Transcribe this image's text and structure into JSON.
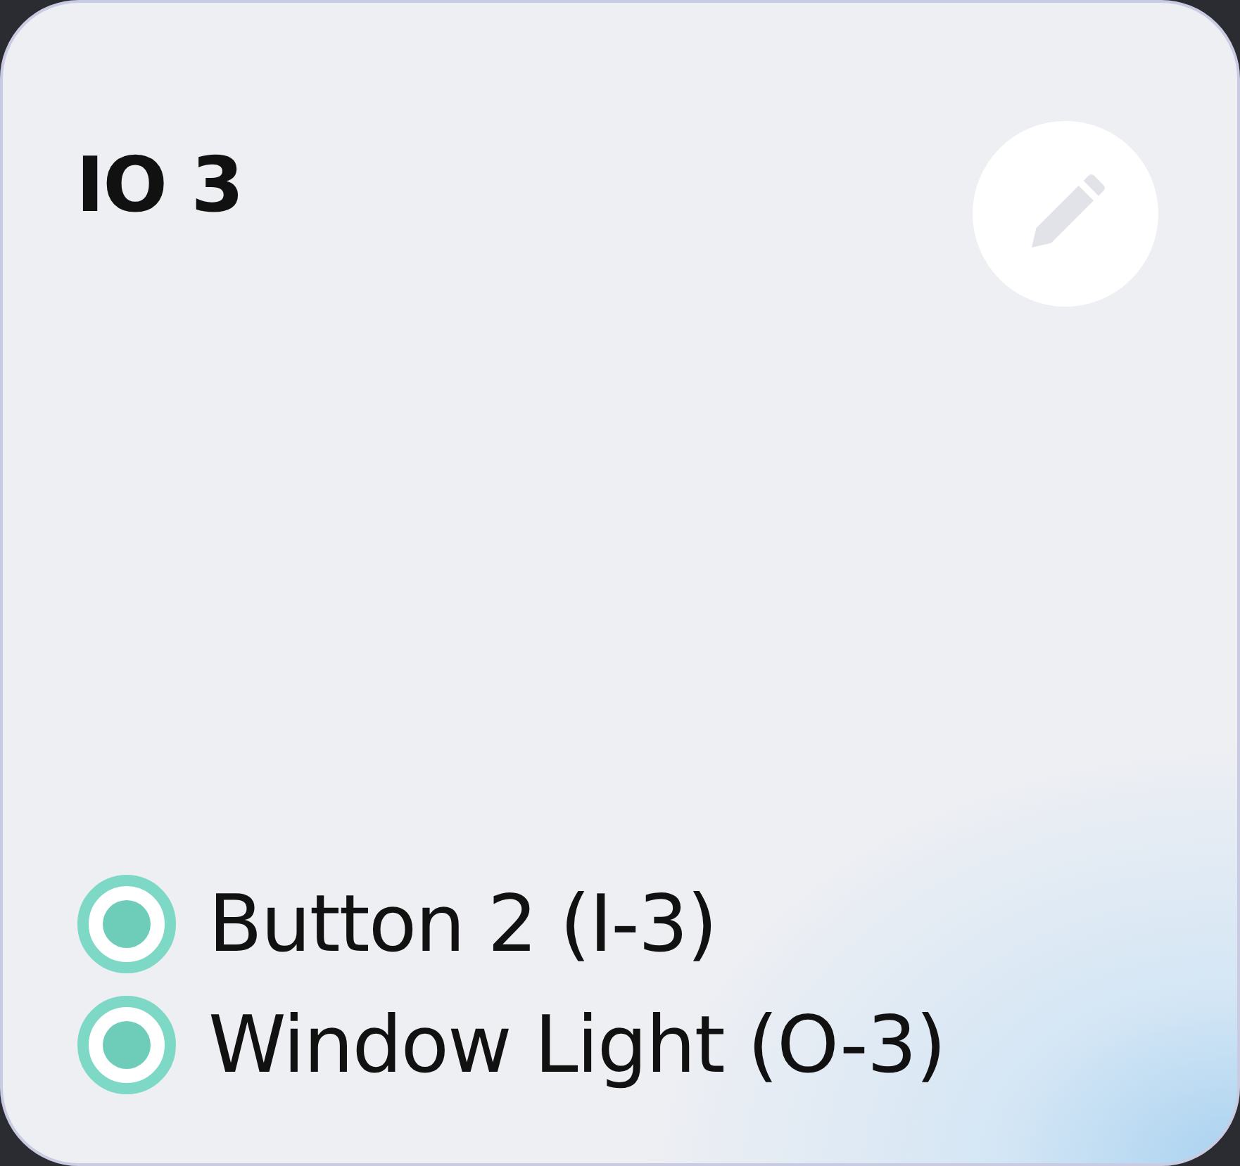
{
  "card": {
    "title": "IO 3",
    "items": [
      {
        "label": "Button 2 (I-3)",
        "selected": true
      },
      {
        "label": "Window Light (O-3)",
        "selected": true
      }
    ]
  }
}
